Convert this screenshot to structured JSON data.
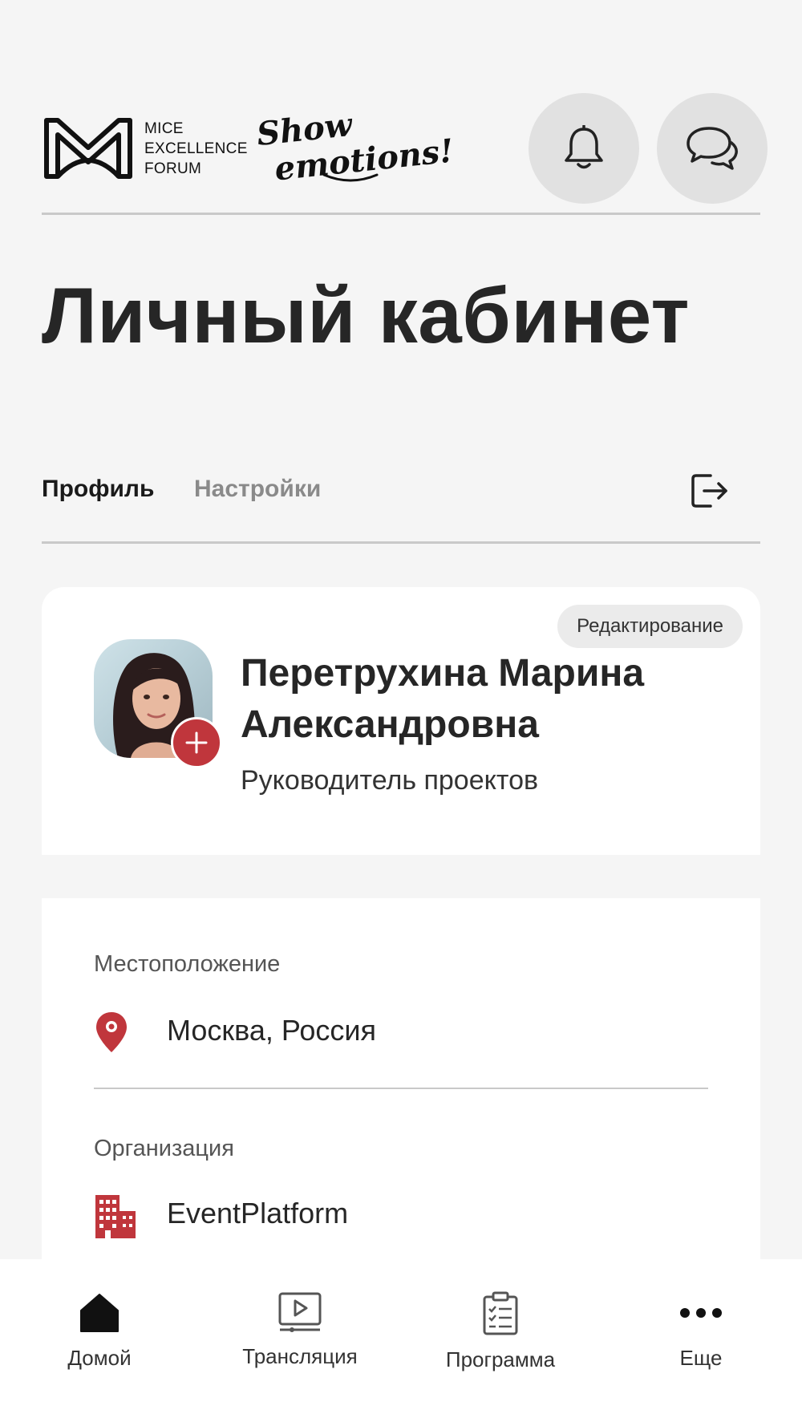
{
  "header": {
    "logo_text": [
      "MICE",
      "EXCELLENCE",
      "FORUM"
    ],
    "tagline_line1": "Show",
    "tagline_line2": "emotions!",
    "notifications_icon": "bell-icon",
    "chat_icon": "chat-bubbles-icon"
  },
  "page_title": "Личный кабинет",
  "tabs": {
    "profile": "Профиль",
    "settings": "Настройки",
    "logout_icon": "logout-icon"
  },
  "profile": {
    "edit_label": "Редактирование",
    "full_name": "Перетрухина Марина Александровна",
    "role": "Руководитель проектов",
    "add_photo_icon": "plus-icon"
  },
  "info": {
    "location_label": "Местоположение",
    "location_value": "Москва, Россия",
    "location_icon": "map-pin-icon",
    "organization_label": "Организация",
    "organization_value": "EventPlatform",
    "organization_icon": "building-icon"
  },
  "bottom_nav": [
    {
      "label": "Домой",
      "icon": "home-icon"
    },
    {
      "label": "Трансляция",
      "icon": "broadcast-icon"
    },
    {
      "label": "Программа",
      "icon": "clipboard-icon"
    },
    {
      "label": "Еще",
      "icon": "more-dots-icon"
    }
  ],
  "colors": {
    "accent": "#c0363c",
    "background": "#f5f5f5",
    "card": "#ffffff",
    "muted_text": "#8a8a8a"
  }
}
